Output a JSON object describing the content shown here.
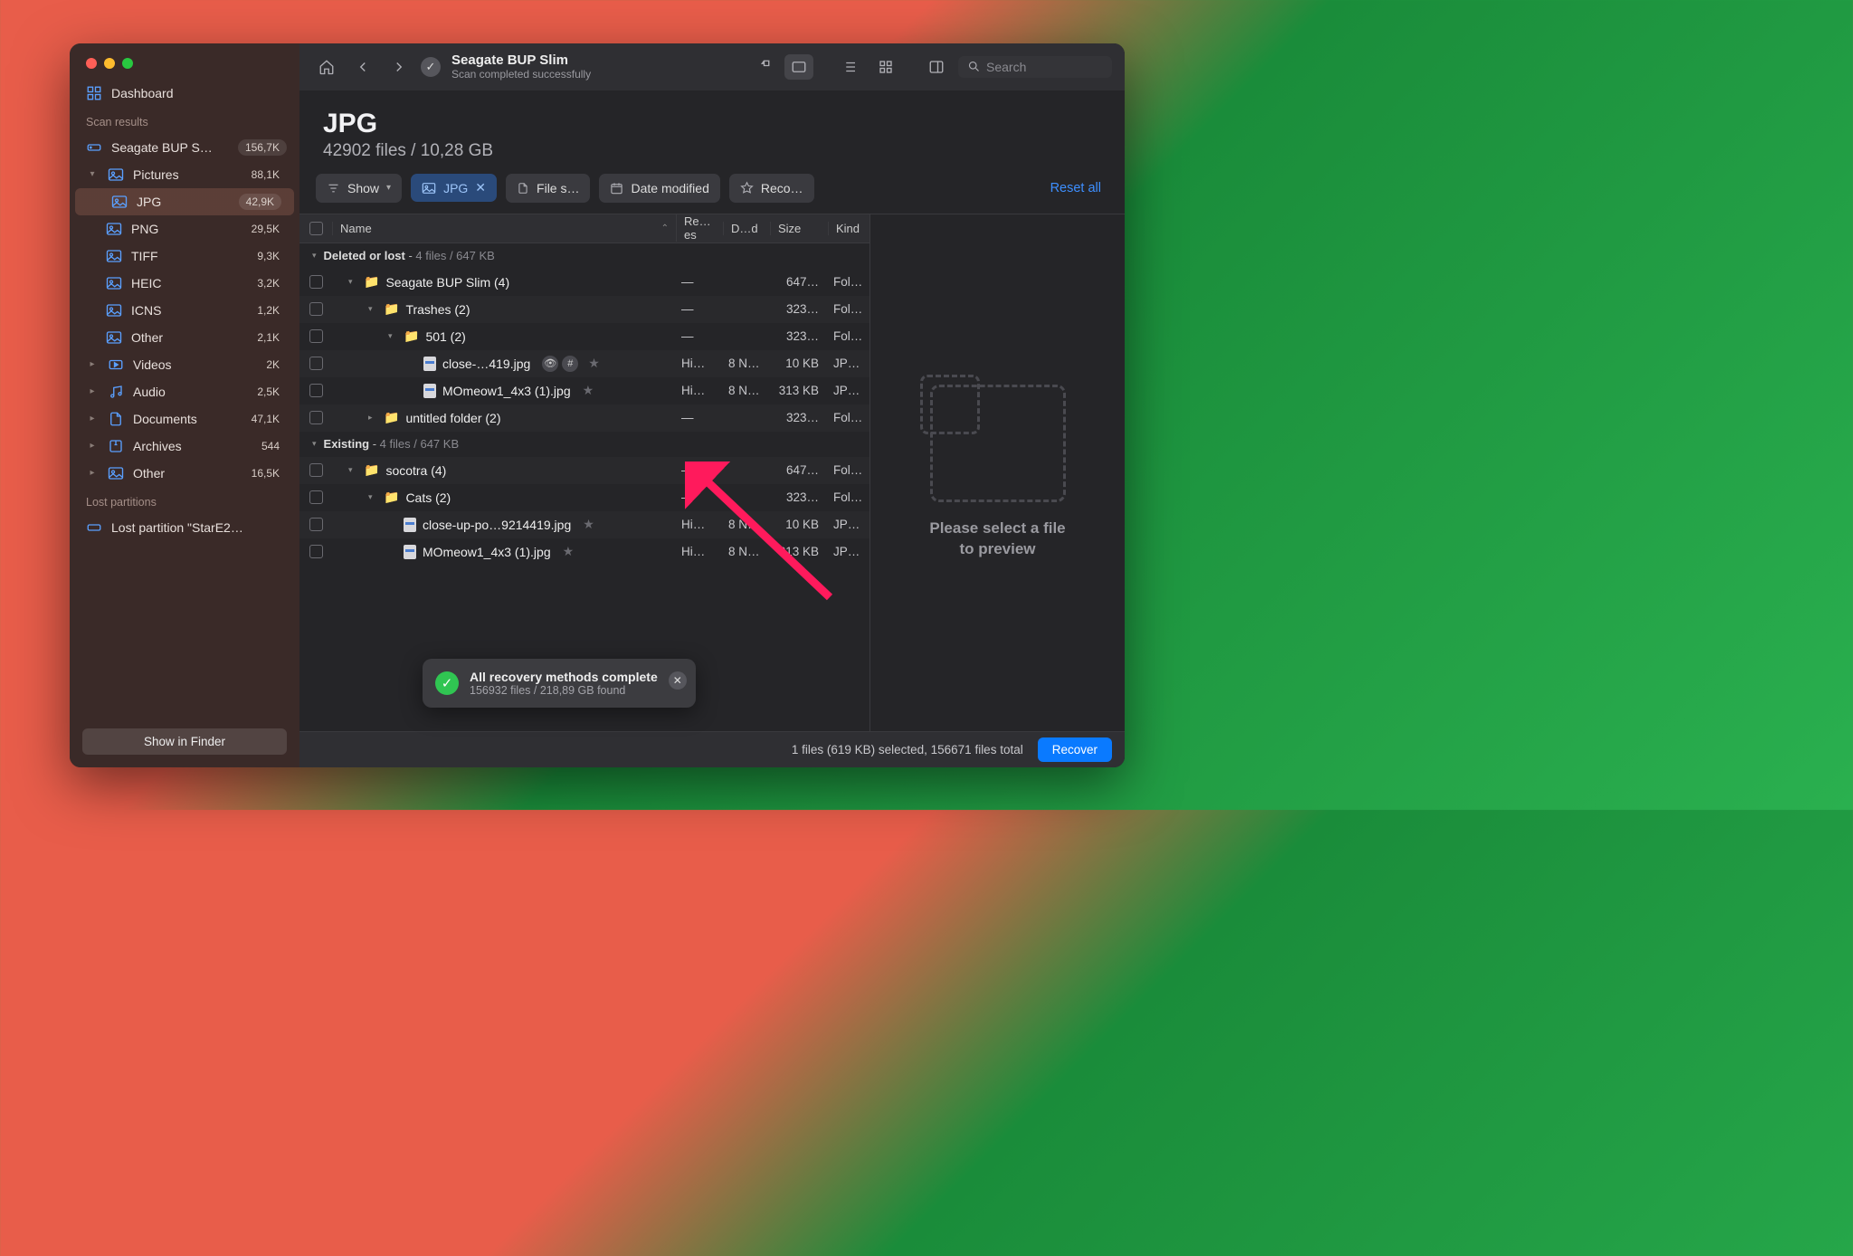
{
  "header": {
    "title": "Seagate BUP Slim",
    "subtitle": "Scan completed successfully",
    "search_placeholder": "Search"
  },
  "sidebar": {
    "dashboard": "Dashboard",
    "scan_results_label": "Scan results",
    "source": {
      "name": "Seagate BUP S…",
      "count": "156,7K"
    },
    "tree": [
      {
        "label": "Pictures",
        "count": "88,1K",
        "expanded": true,
        "children": [
          {
            "label": "JPG",
            "count": "42,9K",
            "active": true
          },
          {
            "label": "PNG",
            "count": "29,5K"
          },
          {
            "label": "TIFF",
            "count": "9,3K"
          },
          {
            "label": "HEIC",
            "count": "3,2K"
          },
          {
            "label": "ICNS",
            "count": "1,2K"
          },
          {
            "label": "Other",
            "count": "2,1K"
          }
        ]
      },
      {
        "label": "Videos",
        "count": "2K"
      },
      {
        "label": "Audio",
        "count": "2,5K"
      },
      {
        "label": "Documents",
        "count": "47,1K"
      },
      {
        "label": "Archives",
        "count": "544"
      },
      {
        "label": "Other",
        "count": "16,5K"
      }
    ],
    "lost_label": "Lost partitions",
    "lost_item": "Lost partition \"StarE2…",
    "footer": "Show in Finder"
  },
  "page": {
    "title": "JPG",
    "subtitle": "42902 files / 10,28 GB"
  },
  "filters": {
    "show": "Show",
    "active": "JPG",
    "size": "File s…",
    "date": "Date modified",
    "chances": "Reco…",
    "reset": "Reset all"
  },
  "columns": {
    "name": "Name",
    "chances": "Re…es",
    "date": "D…d",
    "size": "Size",
    "kind": "Kind"
  },
  "groups": [
    {
      "title": "Deleted or lost",
      "meta": "4 files / 647 KB",
      "rows": [
        {
          "indent": 1,
          "type": "folder",
          "name": "Seagate BUP Slim (4)",
          "chances": "—",
          "date": "",
          "size": "647…",
          "kind": "Fol…"
        },
        {
          "indent": 2,
          "type": "folder",
          "name": "Trashes (2)",
          "chances": "—",
          "date": "",
          "size": "323…",
          "kind": "Fol…"
        },
        {
          "indent": 3,
          "type": "folder",
          "name": "501 (2)",
          "chances": "—",
          "date": "",
          "size": "323…",
          "kind": "Fol…"
        },
        {
          "indent": 4,
          "type": "file",
          "name": "close-…419.jpg",
          "badges": true,
          "chances": "Hi…",
          "date": "8 N…",
          "size": "10 KB",
          "kind": "JP…"
        },
        {
          "indent": 4,
          "type": "file",
          "name": "MOmeow1_4x3 (1).jpg",
          "star": true,
          "chances": "Hi…",
          "date": "8 N…",
          "size": "313 KB",
          "kind": "JP…"
        },
        {
          "indent": 2,
          "type": "folder",
          "name": "untitled folder (2)",
          "collapsed": true,
          "chances": "—",
          "date": "",
          "size": "323…",
          "kind": "Fol…"
        }
      ]
    },
    {
      "title": "Existing",
      "meta": "4 files / 647 KB",
      "rows": [
        {
          "indent": 1,
          "type": "folder",
          "name": "socotra (4)",
          "chances": "—",
          "date": "",
          "size": "647…",
          "kind": "Fol…"
        },
        {
          "indent": 2,
          "type": "folder",
          "name": "Cats (2)",
          "chances": "—",
          "date": "",
          "size": "323…",
          "kind": "Fol…"
        },
        {
          "indent": 3,
          "type": "file",
          "name": "close-up-po…9214419.jpg",
          "star": true,
          "chances": "Hi…",
          "date": "8 N…",
          "size": "10 KB",
          "kind": "JP…"
        },
        {
          "indent": 3,
          "type": "file",
          "name": "MOmeow1_4x3 (1).jpg",
          "star": true,
          "chances": "Hi…",
          "date": "8 N…",
          "size": "313 KB",
          "kind": "JP…"
        }
      ]
    }
  ],
  "preview": {
    "message_l1": "Please select a file",
    "message_l2": "to preview"
  },
  "status": {
    "text": "1 files (619 KB) selected, 156671 files total",
    "recover": "Recover"
  },
  "toast": {
    "title": "All recovery methods complete",
    "detail": "156932 files / 218,89 GB found"
  }
}
